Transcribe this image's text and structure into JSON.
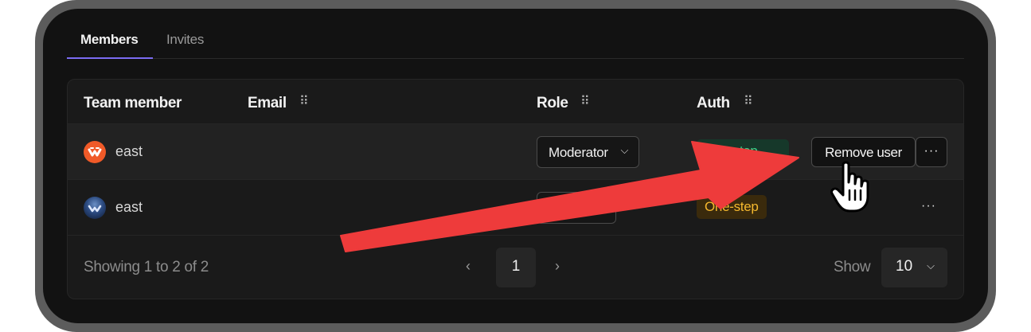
{
  "tabs": [
    {
      "label": "Members",
      "active": true
    },
    {
      "label": "Invites",
      "active": false
    }
  ],
  "table": {
    "columns": [
      "Team member",
      "Email",
      "Role",
      "Auth"
    ],
    "rows": [
      {
        "name": "east",
        "role": "Moderator",
        "auth": "Two-step",
        "auth_color": "#3dd68c",
        "actions": {
          "remove": "Remove user",
          "more": "···"
        }
      },
      {
        "name": "east",
        "role": "Owner",
        "auth": "One-step",
        "auth_color": "#f5b82e",
        "actions": {
          "more": "···"
        }
      }
    ]
  },
  "footer": {
    "showing": "Showing 1 to 2 of 2",
    "prev": "‹",
    "current_page": "1",
    "next": "›",
    "show_label": "Show",
    "page_size": "10"
  },
  "colors": {
    "accent": "#7b6cf2",
    "arrow": "#ee3b3b",
    "background": "#121212"
  },
  "icons": {
    "grip": "⠿",
    "chevron": "⌵"
  }
}
